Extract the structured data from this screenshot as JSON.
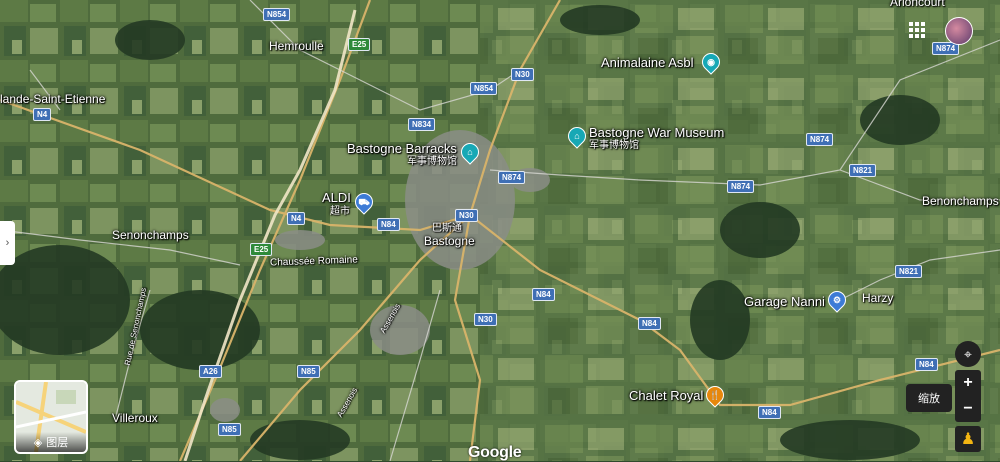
{
  "places": {
    "hemroulle": "Hemroulle",
    "mande": "lande-Saint-Etienne",
    "senonchamps": "Senonchamps",
    "bastogne_cn": "巴斯通",
    "bastogne": "Bastogne",
    "benonchamps": "Benonchamps",
    "harzy": "Harzy",
    "villeroux": "Villeroux",
    "arloncourt": "Arloncourt"
  },
  "pois": {
    "animalaine": "Animalaine Asbl",
    "war_museum": "Bastogne War Museum",
    "war_museum_cn": "军事博物馆",
    "barracks": "Bastogne Barracks",
    "barracks_cn": "军事博物馆",
    "aldi": "ALDI",
    "aldi_cn": "超市",
    "garage": "Garage Nanni",
    "chalet": "Chalet Royal"
  },
  "roads": {
    "chaussee": "Chaussée Romaine",
    "rue_senonchamps": "Rue de Senonchamps",
    "assenois1": "Assenois",
    "assenois2": "Assenois"
  },
  "shields": {
    "n854_top": "N854",
    "e25_top": "E25",
    "n30_top": "N30",
    "n854_mid": "N854",
    "n834": "N834",
    "n874_a": "N874",
    "n874_b": "N874",
    "n874_c": "N874",
    "n874_d": "N874",
    "n821_a": "N821",
    "n821_b": "N821",
    "n4_left": "N4",
    "n4_mid": "N4",
    "n84_a": "N84",
    "n30_mid": "N30",
    "e25_mid": "E25",
    "n84_b": "N84",
    "n30_low": "N30",
    "n84_c": "N84",
    "n84_d": "N84",
    "n84_e": "N84",
    "a26": "A26",
    "n85_a": "N85",
    "n85_b": "N85"
  },
  "controls": {
    "layers_label": "图层",
    "zoom_tooltip": "缩放",
    "zoom_in": "+",
    "zoom_out": "−",
    "google": "Google"
  },
  "colors": {
    "road_major": "#d9b46a",
    "road_minor": "#cfcfcf",
    "poi_teal": "#17a8b5",
    "poi_blue": "#3d7bd6",
    "poi_orange": "#e8870c"
  }
}
